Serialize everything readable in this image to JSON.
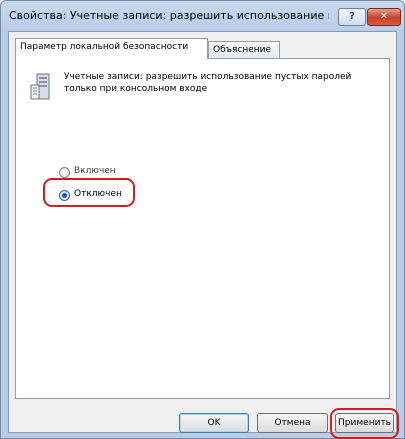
{
  "window": {
    "title": "Свойства: Учетные записи: разрешить использование пуст...",
    "help_label": "?",
    "close_label": "✕"
  },
  "tabs": [
    {
      "label": "Параметр локальной безопасности",
      "active": true
    },
    {
      "label": "Объяснение",
      "active": false
    }
  ],
  "policy": {
    "description_line1": "Учетные записи: разрешить использование пустых паролей",
    "description_line2": "только при консольном входе",
    "icon": "server-policy-icon"
  },
  "options": [
    {
      "label": "Включен",
      "checked": false
    },
    {
      "label": "Отключен",
      "checked": true
    }
  ],
  "buttons": {
    "ok": "OK",
    "cancel": "Отмена",
    "apply": "Применить"
  },
  "colors": {
    "highlight": "#d21d24",
    "accent": "#1b54b3"
  }
}
